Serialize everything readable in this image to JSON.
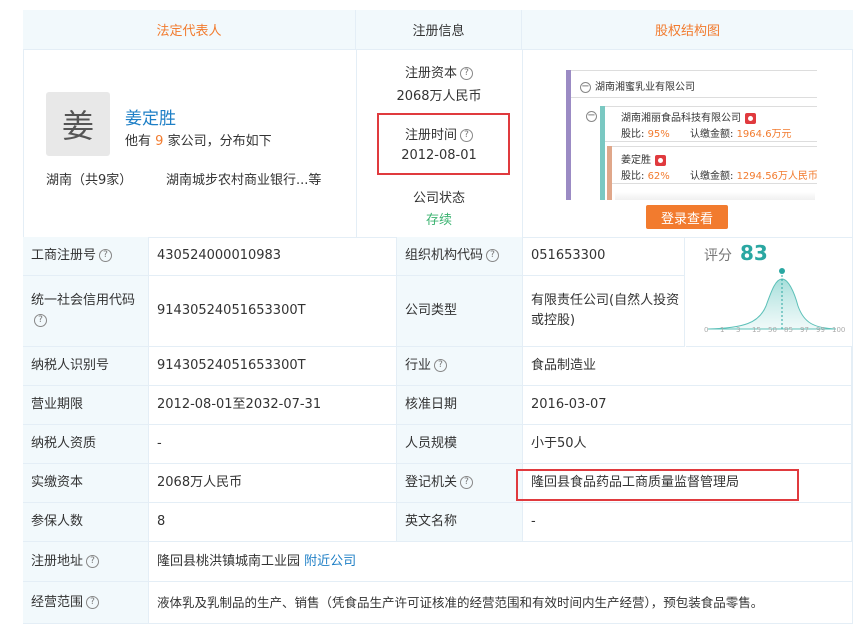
{
  "headers": {
    "legal_rep": "法定代表人",
    "reg_info": "注册信息",
    "equity": "股权结构图"
  },
  "person": {
    "avatar_char": "姜",
    "name": "姜定胜",
    "company_prefix": "他有",
    "company_count": "9",
    "company_suffix": "家公司，分布如下",
    "region": "湖南（共9家）",
    "companies": "湖南城步农村商业银行...等"
  },
  "reg": {
    "capital_label": "注册资本",
    "capital_value": "2068万人民币",
    "time_label": "注册时间",
    "time_value": "2012-08-01",
    "status_label": "公司状态",
    "status_value": "存续"
  },
  "equity_tree": {
    "root": "湖南湘蜜乳业有限公司",
    "child1_name": "湖南湘丽食品科技有限公司",
    "child1_ratio_label": "股比:",
    "child1_ratio": "95%",
    "child1_sub_label": "认缴金额:",
    "child1_sub": "1964.6万元",
    "child2_name": "姜定胜",
    "child2_ratio_label": "股比:",
    "child2_ratio": "62%",
    "child2_sub_label": "认缴金额:",
    "child2_sub": "1294.56万人民币",
    "login_button": "登录查看"
  },
  "score": {
    "label": "评分",
    "value": "83",
    "ticks": [
      "0",
      "1",
      "3",
      "15",
      "50",
      "85",
      "97",
      "99",
      "100"
    ]
  },
  "rows": [
    {
      "l1": "工商注册号",
      "l1q": true,
      "v1": "430524000010983",
      "l2": "组织机构代码",
      "l2q": true,
      "v2": "051653300"
    },
    {
      "l1": "统一社会信用代码",
      "l1q": true,
      "v1": "91430524051653300T",
      "l2": "公司类型",
      "l2q": false,
      "v2": "有限责任公司(自然人投资或控股)"
    },
    {
      "l1": "纳税人识别号",
      "l1q": false,
      "v1": "91430524051653300T",
      "l2": "行业",
      "l2q": true,
      "v2": "食品制造业"
    },
    {
      "l1": "营业期限",
      "l1q": false,
      "v1": "2012-08-01至2032-07-31",
      "l2": "核准日期",
      "l2q": false,
      "v2": "2016-03-07"
    },
    {
      "l1": "纳税人资质",
      "l1q": false,
      "v1": "-",
      "l2": "人员规模",
      "l2q": false,
      "v2": "小于50人"
    },
    {
      "l1": "实缴资本",
      "l1q": false,
      "v1": "2068万人民币",
      "l2": "登记机关",
      "l2q": true,
      "v2": "隆回县食品药品工商质量监督管理局"
    },
    {
      "l1": "参保人数",
      "l1q": false,
      "v1": "8",
      "l2": "英文名称",
      "l2q": false,
      "v2": "-"
    }
  ],
  "address": {
    "label": "注册地址",
    "value": "隆回县桃洪镇城南工业园",
    "link": "附近公司"
  },
  "scope": {
    "label": "经营范围",
    "value": "液体乳及乳制品的生产、销售（凭食品生产许可证核准的经营范围和有效时间内生产经营），预包装食品零售。"
  },
  "colors": {
    "accent_orange": "#f27b2e",
    "link_blue": "#1e7fc6",
    "status_green": "#3cb371",
    "highlight_red": "#e03a3e",
    "score_teal": "#2aa7a2"
  }
}
